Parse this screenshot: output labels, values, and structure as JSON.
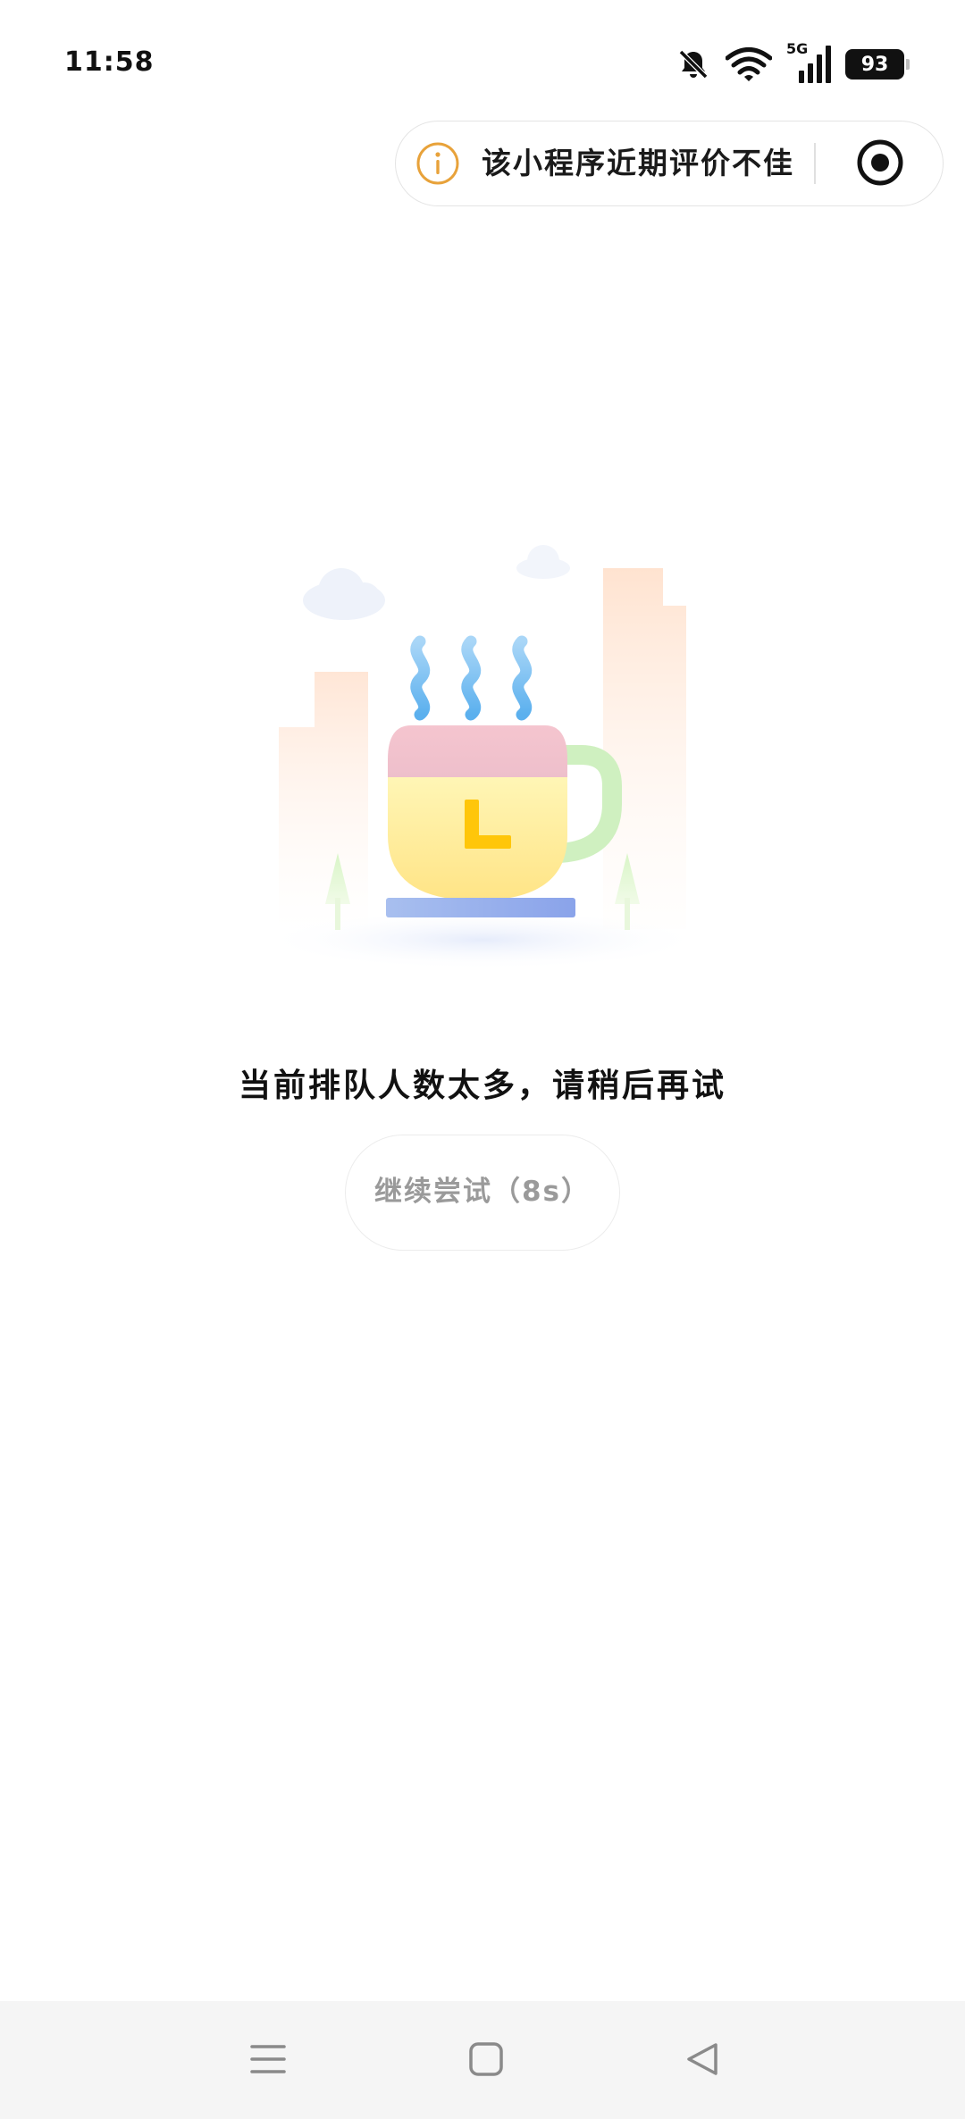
{
  "status_bar": {
    "time": "11:58",
    "network": "5G",
    "battery": "93",
    "icons": [
      "mute-bell-icon",
      "wifi-icon",
      "signal-icon",
      "battery-icon"
    ]
  },
  "capsule": {
    "notice_text": "该小程序近期评价不佳",
    "info_icon": "info-icon",
    "close_icon": "close-target-icon"
  },
  "illustration": {
    "name": "coffee-cup-waiting-illustration"
  },
  "main": {
    "message": "当前排队人数太多，请稍后再试",
    "retry_button_label": "继续尝试（8s）"
  },
  "nav_bar": {
    "items": [
      "menu-icon",
      "home-icon",
      "back-icon"
    ]
  },
  "colors": {
    "accent_orange": "#E8A23A",
    "cup_yellow": "#FFF3A6",
    "cup_pink": "#F3C1CF",
    "handle_green": "#CDEFBE",
    "saucer_blue": "#8EA8EA",
    "steam_blue": "#6EB8F0",
    "clock_hand": "#FFC60A"
  }
}
